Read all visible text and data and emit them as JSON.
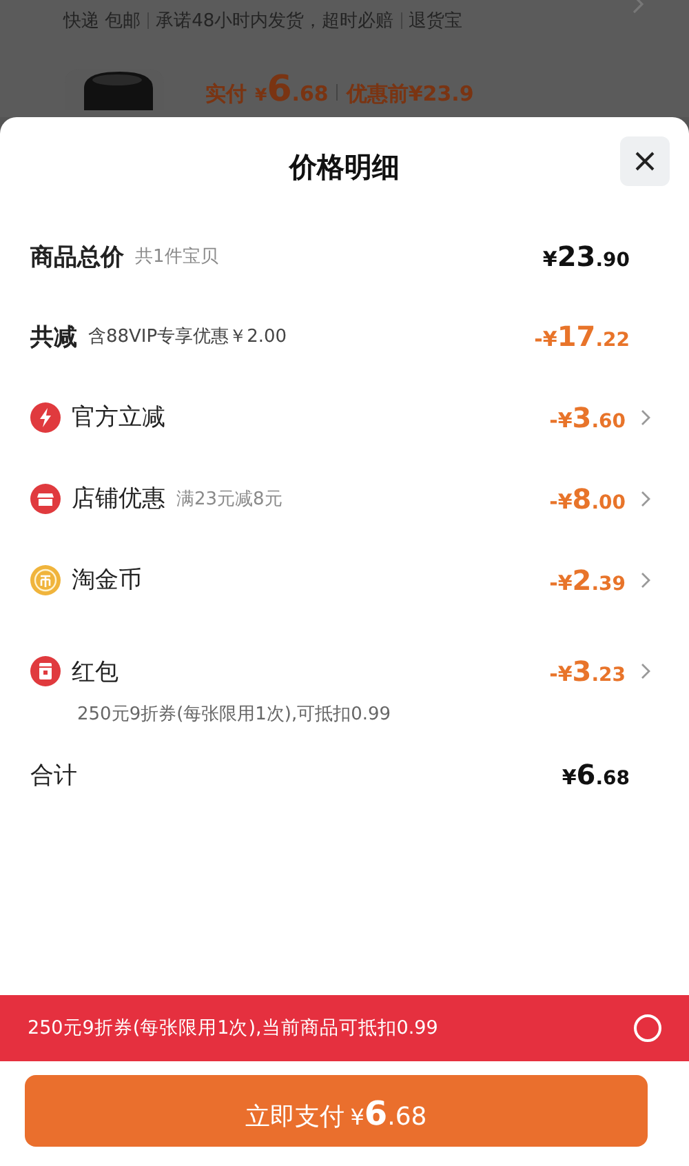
{
  "background": {
    "services": [
      "快递 包邮",
      "承诺48小时内发货，超时必赔",
      "退货宝"
    ],
    "product": {
      "paid_label": "实付",
      "paid": {
        "symbol": "¥",
        "integer": "6",
        "decimal": ".68"
      },
      "before_label": "优惠前",
      "before": "¥23.9"
    }
  },
  "sheet": {
    "title": "价格明细",
    "total_goods": {
      "label": "商品总价",
      "note": "共1件宝贝",
      "price": {
        "symbol": "¥",
        "integer": "23",
        "decimal": ".90"
      }
    },
    "total_discount": {
      "label": "共减",
      "note": "含88VIP专享优惠￥2.00",
      "price": {
        "symbol": "-¥",
        "integer": "17",
        "decimal": ".22"
      }
    },
    "discounts": [
      {
        "kind": "bolt",
        "label": "官方立减",
        "price": {
          "symbol": "-¥",
          "integer": "3",
          "decimal": ".60"
        }
      },
      {
        "kind": "shop",
        "label": "店铺优惠",
        "note": "满23元减8元",
        "price": {
          "symbol": "-¥",
          "integer": "8",
          "decimal": ".00"
        }
      },
      {
        "kind": "coin",
        "label": "淘金币",
        "price": {
          "symbol": "-¥",
          "integer": "2",
          "decimal": ".39"
        }
      },
      {
        "kind": "red_packet",
        "label": "红包",
        "detail": "250元9折券(每张限用1次),可抵扣0.99",
        "price": {
          "symbol": "-¥",
          "integer": "3",
          "decimal": ".23"
        }
      }
    ],
    "sum": {
      "label": "合计",
      "price": {
        "symbol": "¥",
        "integer": "6",
        "decimal": ".68"
      }
    },
    "coupon_bar": {
      "text": "250元9折券(每张限用1次),当前商品可抵扣0.99",
      "checked": false
    },
    "pay_button": {
      "label": "立即支付",
      "price": {
        "symbol": "¥",
        "integer": "6",
        "decimal": ".68"
      }
    }
  }
}
